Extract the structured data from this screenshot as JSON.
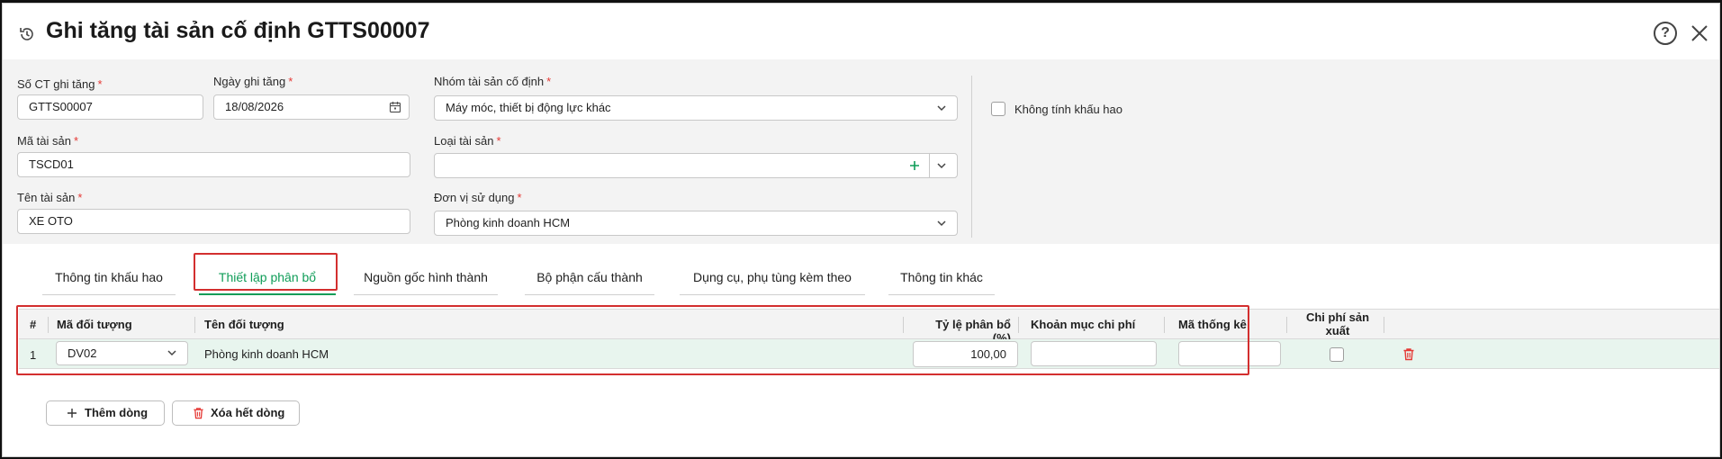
{
  "header": {
    "title": "Ghi tăng tài sản cố định GTTS00007",
    "help_glyph": "?"
  },
  "form": {
    "so_ct": {
      "label": "Số CT ghi tăng",
      "value": "GTTS00007"
    },
    "ngay_ghi_tang": {
      "label": "Ngày ghi tăng",
      "value": "18/08/2026"
    },
    "nhom_tai_san": {
      "label": "Nhóm tài sản cố định",
      "value": "Máy móc, thiết bị động lực khác"
    },
    "ma_tai_san": {
      "label": "Mã tài sản",
      "value": "TSCD01"
    },
    "loai_tai_san": {
      "label": "Loại tài sản",
      "value": ""
    },
    "ten_tai_san": {
      "label": "Tên tài sản",
      "value": "XE OTO"
    },
    "don_vi_su_dung": {
      "label": "Đơn vị sử dụng",
      "value": "Phòng kinh doanh HCM"
    },
    "khong_tinh_khau_hao": {
      "label": "Không tính khấu hao",
      "checked": false
    },
    "required_mark": "*"
  },
  "tabs": [
    {
      "label": "Thông tin khấu hao",
      "active": false
    },
    {
      "label": "Thiết lập phân bổ",
      "active": true
    },
    {
      "label": "Nguồn gốc hình thành",
      "active": false
    },
    {
      "label": "Bộ phận cấu thành",
      "active": false
    },
    {
      "label": "Dụng cụ, phụ tùng kèm theo",
      "active": false
    },
    {
      "label": "Thông tin khác",
      "active": false
    }
  ],
  "grid": {
    "columns": [
      "#",
      "Mã đối tượng",
      "Tên đối tượng",
      "Tỷ lệ phân bổ (%)",
      "Khoản mục chi phí",
      "Mã thống kê",
      "Chi phí sản xuất"
    ],
    "rows": [
      {
        "index": "1",
        "ma_doi_tuong": "DV02",
        "ten_doi_tuong": "Phòng kinh doanh HCM",
        "ty_le": "100,00",
        "khoan_muc": "",
        "ma_thong_ke": "",
        "chi_phi_sx": false
      }
    ]
  },
  "actions": {
    "add_row": "Thêm dòng",
    "delete_all": "Xóa hết dòng"
  },
  "colors": {
    "accent_green": "#0f9d58",
    "highlight_red": "#d32f2f",
    "row_selected": "#e8f5ee"
  }
}
